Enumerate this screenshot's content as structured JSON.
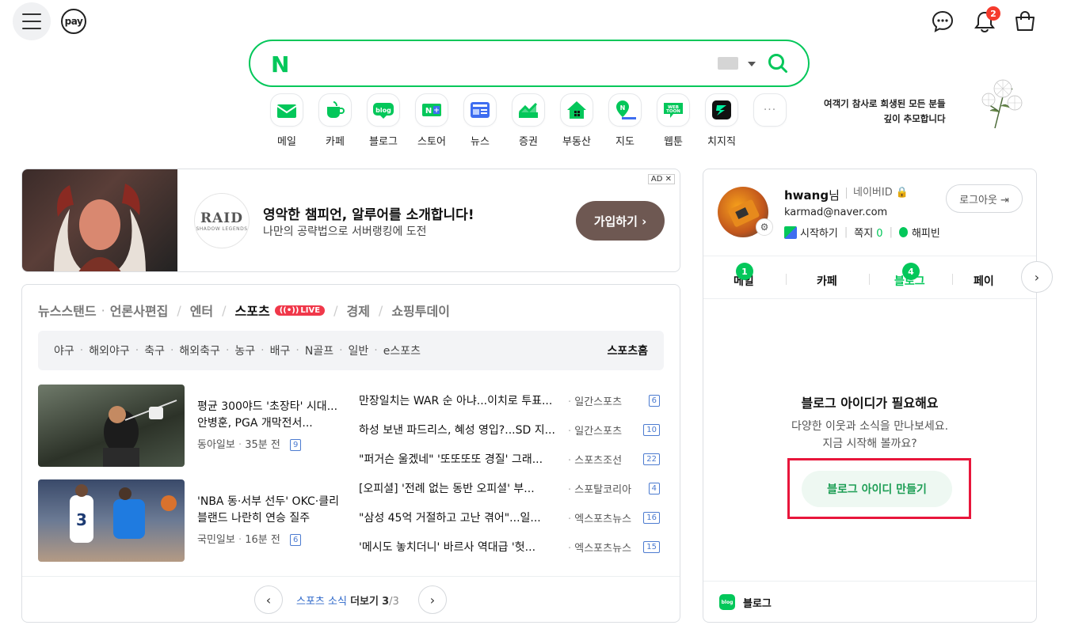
{
  "header": {
    "pay_label": "pay",
    "notif_count": "2"
  },
  "search": {
    "logo": "N",
    "placeholder": ""
  },
  "shortcuts": [
    {
      "label": "메일",
      "icon": "mail-icon"
    },
    {
      "label": "카페",
      "icon": "cafe-icon"
    },
    {
      "label": "블로그",
      "icon": "blog-icon"
    },
    {
      "label": "스토어",
      "icon": "store-icon"
    },
    {
      "label": "뉴스",
      "icon": "news-icon"
    },
    {
      "label": "증권",
      "icon": "stock-icon"
    },
    {
      "label": "부동산",
      "icon": "realestate-icon"
    },
    {
      "label": "지도",
      "icon": "map-icon"
    },
    {
      "label": "웹툰",
      "icon": "webtoon-icon"
    },
    {
      "label": "치지직",
      "icon": "chzzk-icon"
    }
  ],
  "memorial": {
    "line1": "여객기 참사로 희생된 모든 분들",
    "line2": "깊이 추모합니다"
  },
  "ad": {
    "logo_text": "RAID",
    "logo_sub": "SHADOW LEGENDS",
    "title": "영악한 챔피언, 알루어를 소개합니다!",
    "subtitle": "나만의 공략법으로 서버랭킹에 도전",
    "join": "가입하기 ›",
    "mark": "AD ✕"
  },
  "news": {
    "tabs": [
      "뉴스스탠드",
      "언론사편집",
      "엔터",
      "스포츠",
      "경제",
      "쇼핑투데이"
    ],
    "live": "LIVE",
    "subtabs": [
      "야구",
      "해외야구",
      "축구",
      "해외축구",
      "농구",
      "배구",
      "N골프",
      "일반",
      "e스포츠"
    ],
    "sports_home": "스포츠홈",
    "main_articles": [
      {
        "title": "평균 300야드 '초장타' 시대...안병훈, PGA 개막전서...",
        "source": "동아일보",
        "time": "35분 전",
        "count": "9"
      },
      {
        "title": "'NBA 동·서부 선두' OKC·클리블랜드 나란히 연승 질주",
        "source": "국민일보",
        "time": "16분 전",
        "count": "6"
      }
    ],
    "headlines": [
      {
        "title": "만장일치는 WAR 순 아냐...이치로 투표...",
        "source": "일간스포츠",
        "count": "6"
      },
      {
        "title": "하성 보낸 파드리스, 혜성 영입?...SD 지...",
        "source": "일간스포츠",
        "count": "10"
      },
      {
        "title": "\"퍼거슨 울겠네\" '또또또또 경질' 그래...",
        "source": "스포츠조선",
        "count": "22"
      },
      {
        "title": "[오피셜] '전례 없는 동반 오피셜' 부...",
        "source": "스포탈코리아",
        "count": "4"
      },
      {
        "title": "\"삼성 45억 거절하고 고난 겪어\"...일...",
        "source": "엑스포츠뉴스",
        "count": "16"
      },
      {
        "title": "'메시도 놓치더니' 바르사 역대급 '헛...",
        "source": "엑스포츠뉴스",
        "count": "15"
      }
    ],
    "more_prefix": "스포츠 소식",
    "more_label": "더보기",
    "page": "3",
    "page_total": "/3"
  },
  "profile": {
    "name": "hwang",
    "name_suffix": "님",
    "naver_id": "네이버ID 🔒",
    "email": "karmad@naver.com",
    "start": "시작하기",
    "memo_label": "쪽지",
    "memo_count": "0",
    "happybean": "해피빈",
    "logout": "로그아웃 ⇥",
    "tabs": [
      {
        "label": "메일",
        "badge": "1"
      },
      {
        "label": "카페",
        "badge": ""
      },
      {
        "label": "블로그",
        "badge": "4"
      },
      {
        "label": "페이",
        "badge": ""
      }
    ],
    "need_title": "블로그 아이디가 필요해요",
    "need_sub1": "다양한 이웃과 소식을 만나보세요.",
    "need_sub2": "지금 시작해 볼까요?",
    "make_button": "블로그 아이디 만들기",
    "footer_label": "블로그"
  }
}
